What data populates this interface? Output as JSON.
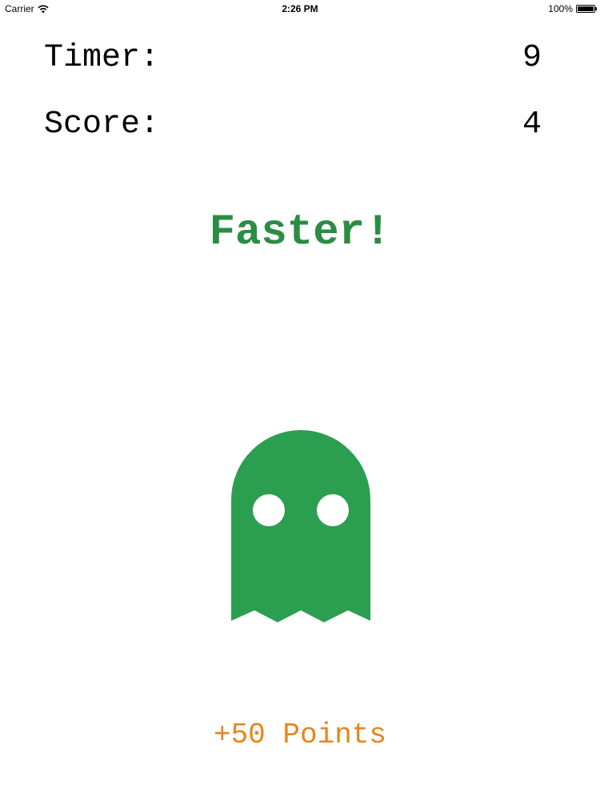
{
  "status_bar": {
    "carrier": "Carrier",
    "time": "2:26 PM",
    "battery": "100%"
  },
  "timer": {
    "label": "Timer:",
    "value": "9"
  },
  "score": {
    "label": "Score:",
    "value": "4"
  },
  "message": "Faster!",
  "points_text": "+50 Points",
  "colors": {
    "ghost": "#2b9e50",
    "message": "#2b8c44",
    "points": "#e7851c"
  },
  "icons": {
    "wifi": "wifi-icon",
    "battery": "battery-icon",
    "ghost": "ghost-icon"
  }
}
